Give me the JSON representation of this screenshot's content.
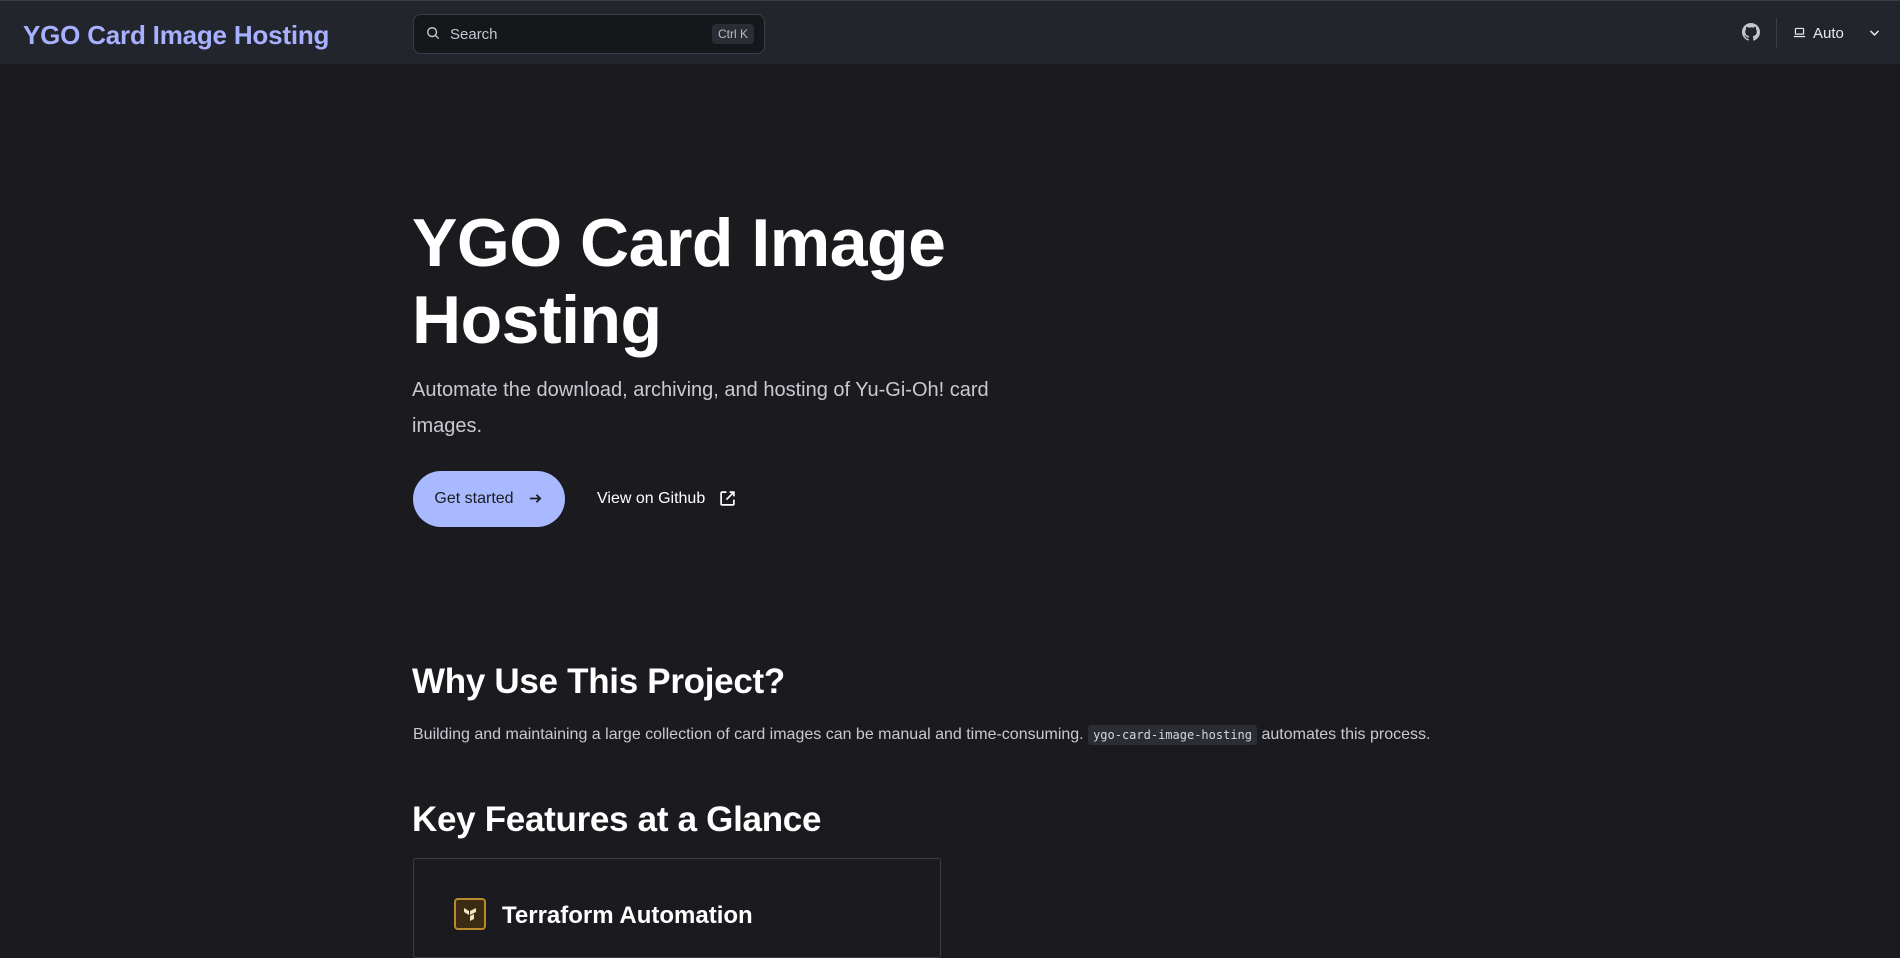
{
  "header": {
    "site_title": "YGO Card Image Hosting",
    "search_placeholder": "Search",
    "search_shortcut": "Ctrl K",
    "theme_label": "Auto"
  },
  "hero": {
    "title": "YGO Card Image Hosting",
    "tagline": "Automate the download, archiving, and hosting of Yu-Gi-Oh! card images.",
    "primary_button": "Get started",
    "secondary_button": "View on Github"
  },
  "why": {
    "title": "Why Use This Project?",
    "text_before": "Building and maintaining a large collection of card images can be manual and time-consuming.",
    "code": "ygo-card-image-hosting",
    "text_after": "automates this process."
  },
  "features": {
    "title": "Key Features at a Glance",
    "cards": [
      {
        "title": "Terraform Automation",
        "icon": "terraform-icon"
      }
    ]
  },
  "colors": {
    "accent": "#a8b1ff",
    "button_bg": "#a8b9ff",
    "page_bg": "#1b1b1f",
    "header_bg": "#23252d"
  }
}
